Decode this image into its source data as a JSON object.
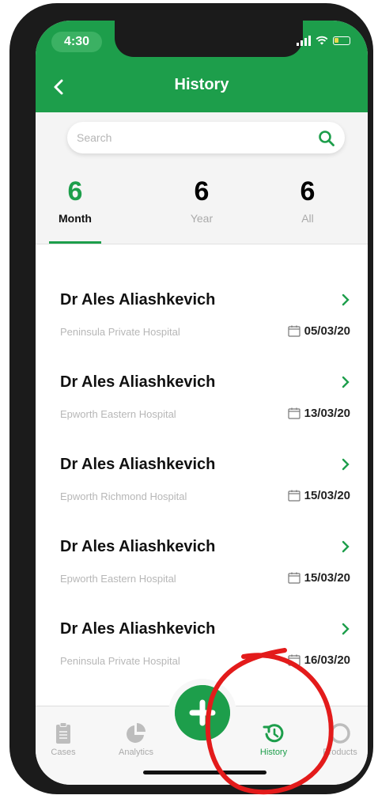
{
  "status": {
    "time": "4:30"
  },
  "header": {
    "title": "History"
  },
  "search": {
    "placeholder": "Search"
  },
  "stats": [
    {
      "value": "6",
      "label": "Month",
      "active": true
    },
    {
      "value": "6",
      "label": "Year",
      "active": false
    },
    {
      "value": "6",
      "label": "All",
      "active": false
    }
  ],
  "cases": [
    {
      "name": "Dr Ales Aliashkevich",
      "hospital": "Peninsula Private Hospital",
      "date": "05/03/20"
    },
    {
      "name": "Dr Ales Aliashkevich",
      "hospital": "Epworth Eastern Hospital",
      "date": "13/03/20"
    },
    {
      "name": "Dr Ales Aliashkevich",
      "hospital": "Epworth Richmond Hospital",
      "date": "15/03/20"
    },
    {
      "name": "Dr Ales Aliashkevich",
      "hospital": "Epworth Eastern Hospital",
      "date": "15/03/20"
    },
    {
      "name": "Dr Ales Aliashkevich",
      "hospital": "Peninsula Private Hospital",
      "date": "16/03/20"
    }
  ],
  "tabs": [
    {
      "label": "Cases",
      "icon": "clipboard-icon",
      "active": false
    },
    {
      "label": "Analytics",
      "icon": "pie-chart-icon",
      "active": false
    },
    {
      "label": "History",
      "icon": "history-icon",
      "active": true
    },
    {
      "label": "Products",
      "icon": "products-icon",
      "active": false
    }
  ],
  "colors": {
    "brand": "#1d9e4b",
    "annotation": "#e31b1b"
  }
}
